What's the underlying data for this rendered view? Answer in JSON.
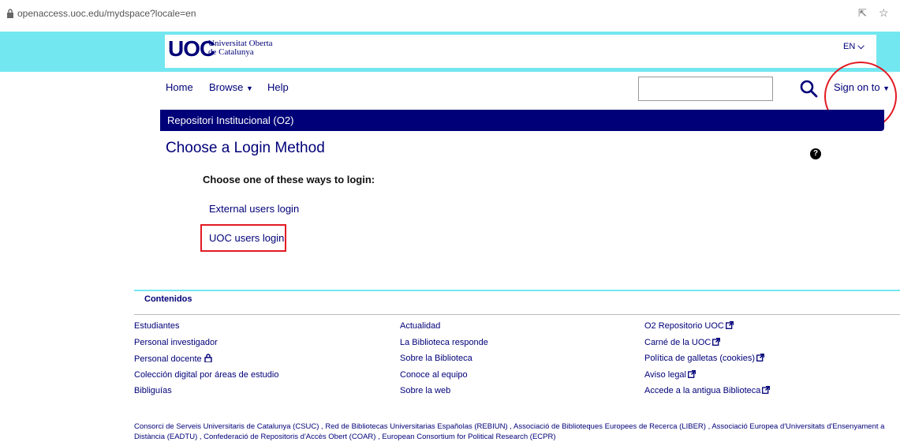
{
  "browser": {
    "url": "openaccess.uoc.edu/mydspace?locale=en"
  },
  "header": {
    "logo_mark": "UOC",
    "logo_line1": "Universitat Oberta",
    "logo_line2": "de Catalunya",
    "language": "EN",
    "brand_color": "#73e7f0",
    "navy_color": "#000078"
  },
  "nav": {
    "home": "Home",
    "browse": "Browse",
    "help": "Help",
    "search_placeholder": "",
    "sign_on": "Sign on to"
  },
  "repo": {
    "title": "Repositori Institucional (O2)"
  },
  "main": {
    "title": "Choose a Login Method",
    "subtitle": "Choose one of these ways to login:",
    "external_login": "External users login",
    "uoc_login": "UOC users login",
    "highlight_color": "#e21a22"
  },
  "footer": {
    "heading": "Contenidos",
    "col1": [
      "Estudiantes",
      "Personal investigador",
      "Personal docente",
      "Colección digital por áreas de estudio",
      "Bibliguías"
    ],
    "col2": [
      "Actualidad",
      "La Biblioteca responde",
      "Sobre la Biblioteca",
      "Conoce al equipo",
      "Sobre la web"
    ],
    "col3": [
      "O2 Repositorio UOC",
      "Carné de la UOC",
      "Política de galletas (cookies)",
      "Aviso legal",
      "Accede a la antigua Biblioteca"
    ],
    "note": "Consorci de Serveis Universitaris de Catalunya (CSUC) , Red de Bibliotecas Universitarias Españolas (REBIUN) , Associació de Biblioteques Europees de Recerca (LIBER) , Associació Europea d'Universitats d'Ensenyament a Distància (EADTU) , Confederació de Repositoris d'Accès Obert (COAR) , European Consortium for Political Research (ECPR)"
  }
}
